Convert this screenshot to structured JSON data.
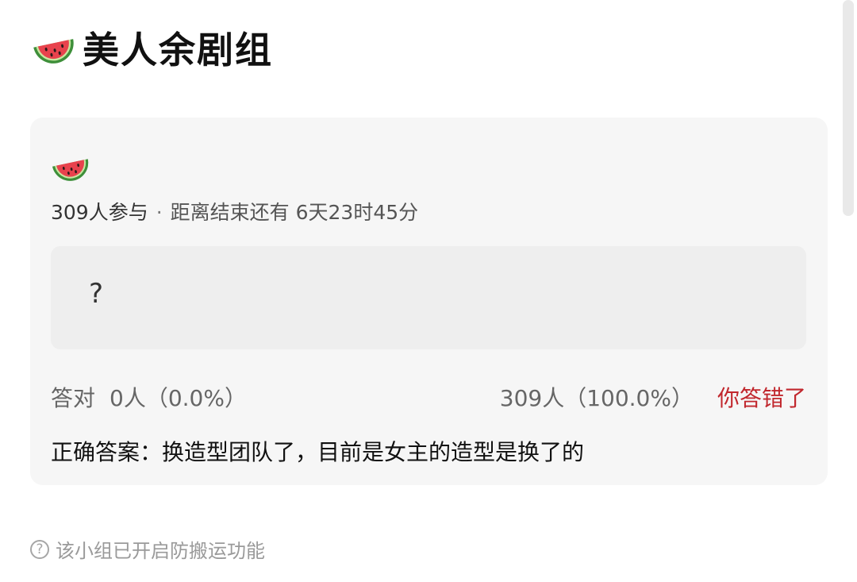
{
  "group": {
    "icon": "watermelon-icon",
    "title": "美人余剧组"
  },
  "quiz": {
    "icon": "watermelon-icon",
    "participants": "309人参与",
    "separator": "·",
    "countdown": "距离结束还有 6天23时45分",
    "question": "?",
    "correct_label": "答对",
    "correct_count": "0人（0.0%）",
    "wrong_count": "309人（100.0%）",
    "result": "你答错了",
    "answer_label": "正确答案：",
    "answer_text": "换造型团队了，目前是女主的造型是换了的"
  },
  "footer": {
    "icon": "question-circle-icon",
    "icon_glyph": "?",
    "text": "该小组已开启防搬运功能"
  },
  "colors": {
    "result_red": "#c1272d",
    "card_bg": "#f6f6f6",
    "question_bg": "#eeeeee",
    "watermelon_flesh": "#e8424d",
    "watermelon_rind": "#4caf50"
  }
}
